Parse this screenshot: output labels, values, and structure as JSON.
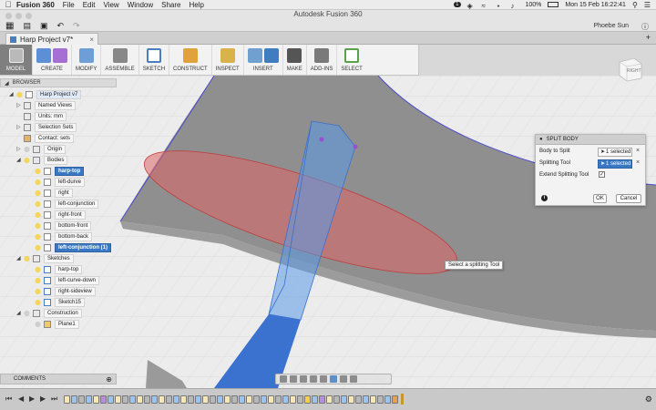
{
  "menubar": {
    "app_name": "Fusion 360",
    "items": [
      "File",
      "Edit",
      "View",
      "Window",
      "Share",
      "Help"
    ],
    "badge_count": "1",
    "battery": "100%",
    "datetime": "Mon 15 Feb  16:22:41"
  },
  "window": {
    "title": "Autodesk Fusion 360",
    "user_name": "Phoebe Sun"
  },
  "document_tab": {
    "label": "Harp Project v7*"
  },
  "toolbar": {
    "model_label": "MODEL",
    "groups": [
      "CREATE",
      "MODIFY",
      "ASSEMBLE",
      "SKETCH",
      "CONSTRUCT",
      "INSPECT",
      "INSERT",
      "MAKE",
      "ADD-INS",
      "SELECT"
    ]
  },
  "viewcube": {
    "face_label": "RIGHT"
  },
  "browser": {
    "header": "BROWSER",
    "root": "Harp Project v7",
    "named_views": "Named Views",
    "units": "Units: mm",
    "selection_sets": "Selection Sets",
    "contact_sets": "Contact: sets",
    "origin": "Origin",
    "bodies": "Bodies",
    "body_items": [
      "harp-top",
      "left-durve",
      "right",
      "left-conjunction",
      "right-front",
      "bottom-front",
      "bottom-back",
      "left-conjunction (1)"
    ],
    "sketches": "Sketches",
    "sketch_items": [
      "harp-top",
      "left-curve-down",
      "right-sideview",
      "Sketch15"
    ],
    "construction": "Construction",
    "construction_items": [
      "Plane1"
    ]
  },
  "comments": {
    "label": "COMMENTS"
  },
  "split_body": {
    "title": "SPLIT BODY",
    "body_to_split_label": "Body to Split",
    "body_to_split_value": "1 selected",
    "splitting_tool_label": "Splitting Tool",
    "splitting_tool_value": "1 selected",
    "extend_label": "Extend Splitting Tool",
    "extend_checked": "✓",
    "ok_label": "OK",
    "cancel_label": "Cancel"
  },
  "tooltip": {
    "text": "Select a splitting Tool"
  },
  "colors": {
    "selection_blue": "#3a78c6",
    "plane_red": "#e06666",
    "body_gray": "#8f8f8f",
    "highlight_blue": "#5b9be8"
  }
}
